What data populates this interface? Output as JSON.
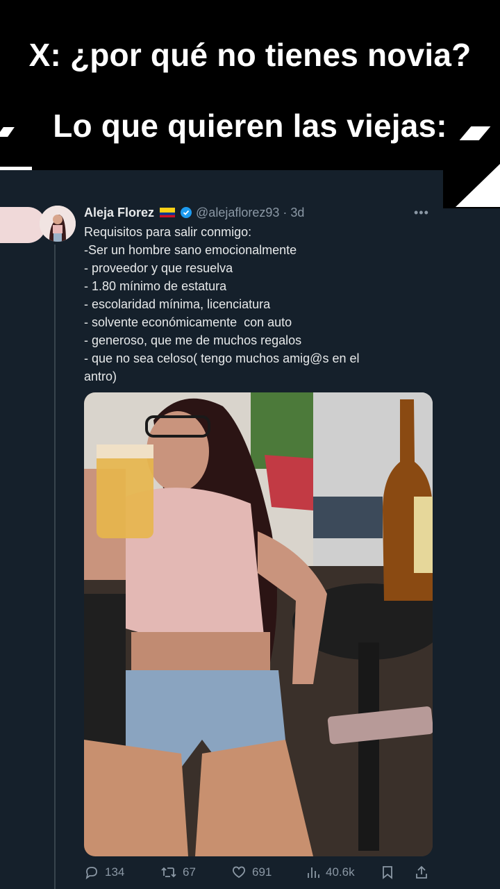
{
  "meme": {
    "line1": "X: ¿por qué no tienes novia?",
    "line2": "Lo que quieren las viejas:"
  },
  "tweet": {
    "author_name": "Aleja Florez",
    "handle_time": "@alejaflorez93 · 3d",
    "text_lines": [
      "Requisitos para salir conmigo:",
      "-Ser un hombre sano emocionalmente",
      "- proveedor y que resuelva",
      "- 1.80 mínimo de estatura",
      "- escolaridad mínima, licenciatura",
      "- solvente económicamente  con auto",
      "- generoso, que me de muchos regalos",
      "- que no sea celoso( tengo muchos amig@s en el",
      "antro)"
    ],
    "stats": {
      "replies": "134",
      "retweets": "67",
      "likes": "691",
      "views": "40.6k"
    }
  },
  "colors": {
    "tweet_bg": "#15202b",
    "text": "#e7e9ea",
    "muted": "#8b98a5",
    "verified": "#1d9bf0"
  },
  "icons": [
    "more-icon",
    "verified-badge-icon",
    "reply-icon",
    "retweet-icon",
    "like-icon",
    "views-icon",
    "bookmark-icon",
    "share-icon"
  ]
}
